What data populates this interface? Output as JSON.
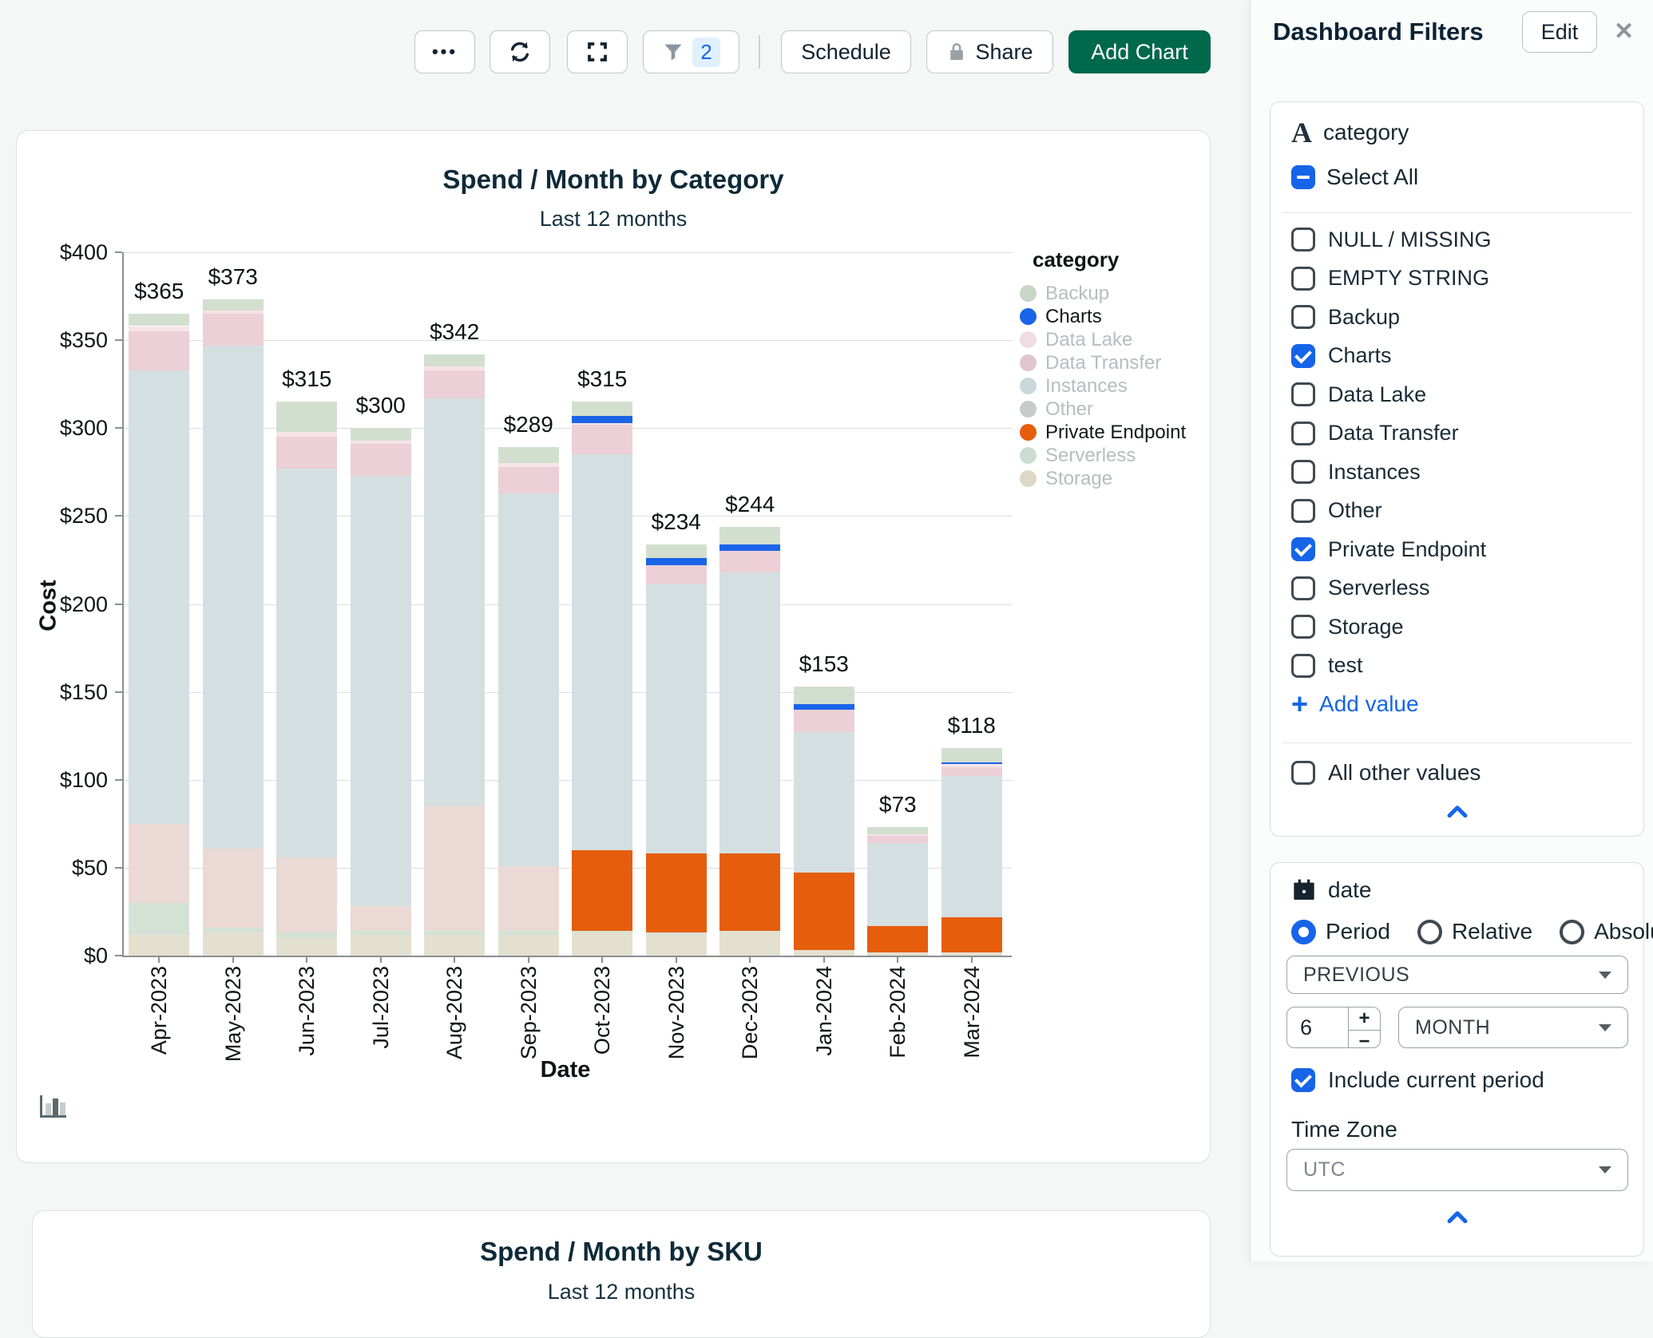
{
  "toolbar": {
    "more_icon": "ellipsis",
    "refresh_icon": "refresh",
    "fullscreen_icon": "fullscreen",
    "filter_icon": "funnel",
    "filter_count": "2",
    "schedule_label": "Schedule",
    "share_label": "Share",
    "add_chart_label": "Add Chart"
  },
  "colors": {
    "accent_blue": "#1665E8",
    "brand_green": "#00684B",
    "orange": "#E55D0D",
    "dark_navy": "#0E2A38"
  },
  "charts": [
    {
      "title": "Spend / Month by Category",
      "subtitle": "Last 12 months"
    },
    {
      "title": "Spend / Month by SKU",
      "subtitle": "Last 12 months"
    }
  ],
  "chart_data": {
    "type": "bar",
    "stacked": true,
    "title": "Spend / Month by Category",
    "subtitle": "Last 12 months",
    "xlabel": "Date",
    "ylabel": "Cost",
    "ylim": [
      0,
      400
    ],
    "ytick_step": 50,
    "ytick_prefix": "$",
    "grid": true,
    "legend_title": "category",
    "legend_position": "right",
    "categories": [
      "Apr-2023",
      "May-2023",
      "Jun-2023",
      "Jul-2023",
      "Aug-2023",
      "Sep-2023",
      "Oct-2023",
      "Nov-2023",
      "Dec-2023",
      "Jan-2024",
      "Feb-2024",
      "Mar-2024"
    ],
    "totals": [
      365,
      373,
      315,
      300,
      342,
      289,
      315,
      234,
      244,
      153,
      73,
      118
    ],
    "total_labels": [
      "$365",
      "$373",
      "$315",
      "$300",
      "$342",
      "$289",
      "$315",
      "$234",
      "$244",
      "$153",
      "$73",
      "$118"
    ],
    "series": [
      {
        "name": "Storage",
        "color": "#E4E0D0",
        "muted": true,
        "values": [
          12,
          13,
          10,
          12,
          12,
          12,
          13,
          12,
          14,
          3,
          2,
          2
        ]
      },
      {
        "name": "Serverless",
        "color": "#D4E2D6",
        "muted": true,
        "values": [
          18,
          3,
          3,
          2,
          2,
          2,
          1,
          1,
          0,
          0,
          0,
          0
        ]
      },
      {
        "name": "Other",
        "color": "#EAD9D4",
        "muted": true,
        "values": [
          45,
          45,
          43,
          14,
          71,
          37,
          0,
          0,
          0,
          0,
          0,
          0
        ]
      },
      {
        "name": "Private Endpoint",
        "color": "#E55D0D",
        "muted": false,
        "values": [
          0,
          0,
          0,
          0,
          0,
          0,
          46,
          45,
          44,
          44,
          15,
          20
        ]
      },
      {
        "name": "Instances",
        "color": "#D4DFE1",
        "muted": true,
        "values": [
          258,
          286,
          221,
          245,
          232,
          212,
          225,
          153,
          160,
          80,
          47,
          80
        ]
      },
      {
        "name": "Data Transfer",
        "color": "#ECCFD7",
        "muted": true,
        "values": [
          22,
          18,
          18,
          18,
          16,
          15,
          17,
          11,
          12,
          13,
          4,
          5
        ]
      },
      {
        "name": "Data Lake",
        "color": "#F5E4E8",
        "muted": true,
        "values": [
          3,
          2,
          3,
          2,
          2,
          2,
          1,
          0,
          0,
          0,
          1,
          2
        ]
      },
      {
        "name": "Charts",
        "color": "#1A64E8",
        "muted": false,
        "values": [
          0,
          0,
          0,
          0,
          0,
          0,
          4,
          4,
          4,
          3,
          0,
          1
        ]
      },
      {
        "name": "Backup",
        "color": "#D2DFCE",
        "muted": true,
        "values": [
          7,
          6,
          17,
          7,
          7,
          9,
          8,
          8,
          10,
          10,
          4,
          8
        ]
      }
    ],
    "legend": [
      {
        "label": "Backup",
        "color": "#C9D5C7",
        "muted": true
      },
      {
        "label": "Charts",
        "color": "#1A64E8",
        "muted": false
      },
      {
        "label": "Data Lake",
        "color": "#F0DCE1",
        "muted": true
      },
      {
        "label": "Data Transfer",
        "color": "#DFC5CE",
        "muted": true
      },
      {
        "label": "Instances",
        "color": "#CAD8DB",
        "muted": true
      },
      {
        "label": "Other",
        "color": "#C6CBCB",
        "muted": true
      },
      {
        "label": "Private Endpoint",
        "color": "#E55D0D",
        "muted": false
      },
      {
        "label": "Serverless",
        "color": "#CBDCD2",
        "muted": true
      },
      {
        "label": "Storage",
        "color": "#DDD8C5",
        "muted": true
      }
    ]
  },
  "sidebar": {
    "title": "Dashboard Filters",
    "edit_label": "Edit",
    "close_icon": "✕",
    "category_filter": {
      "field_type_icon": "A",
      "field_name": "category",
      "select_all": {
        "label": "Select All",
        "state": "indeterminate"
      },
      "values": [
        {
          "label": "NULL / MISSING",
          "checked": false
        },
        {
          "label": "EMPTY STRING",
          "checked": false
        },
        {
          "label": "Backup",
          "checked": false
        },
        {
          "label": "Charts",
          "checked": true
        },
        {
          "label": "Data Lake",
          "checked": false
        },
        {
          "label": "Data Transfer",
          "checked": false
        },
        {
          "label": "Instances",
          "checked": false
        },
        {
          "label": "Other",
          "checked": false
        },
        {
          "label": "Private Endpoint",
          "checked": true
        },
        {
          "label": "Serverless",
          "checked": false
        },
        {
          "label": "Storage",
          "checked": false
        },
        {
          "label": "test",
          "checked": false
        }
      ],
      "add_value_label": "Add value",
      "all_other_values": {
        "label": "All other values",
        "checked": false
      }
    },
    "date_filter": {
      "field_name": "date",
      "modes": [
        {
          "label": "Period",
          "selected": true
        },
        {
          "label": "Relative",
          "selected": false
        },
        {
          "label": "Absolute",
          "selected": false
        }
      ],
      "operator_value": "PREVIOUS",
      "amount_value": "6",
      "unit_value": "MONTH",
      "include_current": {
        "label": "Include current period",
        "checked": true
      },
      "timezone_label": "Time Zone",
      "timezone_value": "UTC"
    }
  }
}
